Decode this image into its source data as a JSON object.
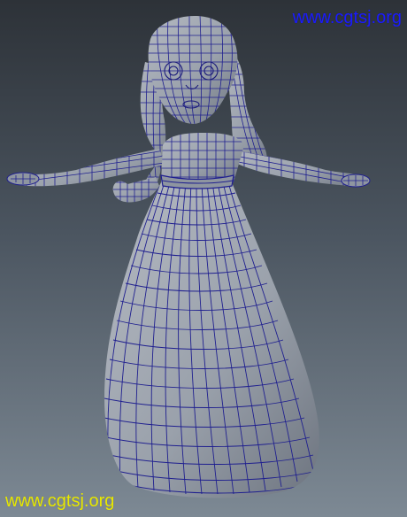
{
  "watermark": {
    "top_right": "www.cgtsj.org",
    "bottom_left": "www.cgtsj.org"
  },
  "colors": {
    "top_watermark": "#1a1aff",
    "bottom_watermark": "#e8e800",
    "wire": "#1f1f8f",
    "mesh_fill": "#8f96a0",
    "mesh_shadow": "#5d6470",
    "background_top": "#2d3238",
    "background_bottom": "#7d8994"
  }
}
